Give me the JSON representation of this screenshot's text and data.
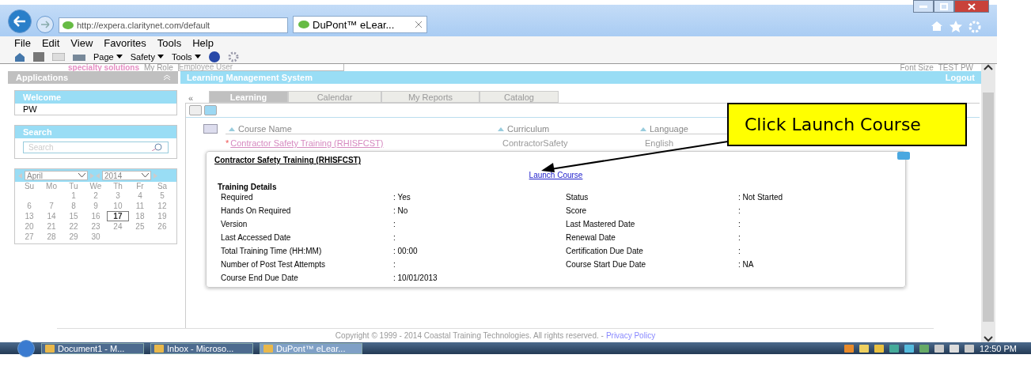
{
  "browser": {
    "address": "http://expera.claritynet.com/default",
    "tab_title": "DuPont™ eLear...",
    "menu": [
      "File",
      "Edit",
      "View",
      "Favorites",
      "Tools",
      "Help"
    ],
    "commands": [
      "Page",
      "Safety",
      "Tools"
    ]
  },
  "header": {
    "brand": "specialty solutions",
    "role_label": "My Role",
    "role_value": "Employee User",
    "font_size_label": "Font Size",
    "user": "TEST PW"
  },
  "left_bar": {
    "title": "Applications"
  },
  "main_bar": {
    "title": "Learning Management System",
    "logout": "Logout"
  },
  "welcome": {
    "title": "Welcome",
    "name": "PW"
  },
  "search": {
    "title": "Search",
    "placeholder": "Search"
  },
  "calendar": {
    "month": "April",
    "year": "2014",
    "weekdays": [
      "Su",
      "Mo",
      "Tu",
      "We",
      "Th",
      "Fr",
      "Sa"
    ],
    "weeks": [
      {
        "kind": "first",
        "days": [
          {
            "day": "1",
            "selected": false
          },
          {
            "day": "2",
            "selected": false
          },
          {
            "day": "3",
            "selected": false
          },
          {
            "day": "4",
            "selected": false
          },
          {
            "day": "5",
            "selected": false
          }
        ]
      },
      {
        "kind": "full",
        "days": [
          {
            "day": "6",
            "selected": false
          },
          {
            "day": "7",
            "selected": false
          },
          {
            "day": "8",
            "selected": false
          },
          {
            "day": "9",
            "selected": false
          },
          {
            "day": "10",
            "selected": false
          },
          {
            "day": "11",
            "selected": false
          },
          {
            "day": "12",
            "selected": false
          }
        ]
      },
      {
        "kind": "full",
        "days": [
          {
            "day": "13",
            "selected": false
          },
          {
            "day": "14",
            "selected": false
          },
          {
            "day": "15",
            "selected": false
          },
          {
            "day": "16",
            "selected": false
          },
          {
            "day": "17",
            "selected": true
          },
          {
            "day": "18",
            "selected": false
          },
          {
            "day": "19",
            "selected": false
          }
        ]
      },
      {
        "kind": "full",
        "days": [
          {
            "day": "20",
            "selected": false
          },
          {
            "day": "21",
            "selected": false
          },
          {
            "day": "22",
            "selected": false
          },
          {
            "day": "23",
            "selected": false
          },
          {
            "day": "24",
            "selected": false
          },
          {
            "day": "25",
            "selected": false
          },
          {
            "day": "26",
            "selected": false
          }
        ]
      },
      {
        "kind": "last",
        "days": [
          {
            "day": "27",
            "selected": false
          },
          {
            "day": "28",
            "selected": false
          },
          {
            "day": "29",
            "selected": false
          },
          {
            "day": "30",
            "selected": false
          }
        ]
      }
    ]
  },
  "collapse": "«",
  "tabs": [
    {
      "label": "Learning",
      "selected": true
    },
    {
      "label": "Calendar",
      "selected": false
    },
    {
      "label": "My Reports",
      "selected": false
    },
    {
      "label": "Catalog",
      "selected": false
    }
  ],
  "table": {
    "columns": [
      "Course Name",
      "Curriculum",
      "Language"
    ],
    "rows": [
      {
        "required_mark": "*",
        "course": "Contractor Safety Training  (RHISFCST)",
        "curriculum": "ContractorSafety",
        "language": "English"
      }
    ]
  },
  "popup": {
    "title": "Contractor Safety Training  (RHISFCST)",
    "launch": "Launch Course",
    "section": "Training Details",
    "left": [
      {
        "label": "Required",
        "value": ": Yes"
      },
      {
        "label": "Hands On Required",
        "value": ": No"
      },
      {
        "label": "Version",
        "value": ":"
      },
      {
        "label": "Last Accessed Date",
        "value": ":"
      },
      {
        "label": "Total Training Time (HH:MM)",
        "value": ": 00:00"
      },
      {
        "label": "Number of Post Test Attempts",
        "value": ":"
      },
      {
        "label": "Course End Due Date",
        "value": ": 10/01/2013"
      }
    ],
    "right": [
      {
        "label": "Status",
        "value": ": Not Started"
      },
      {
        "label": "Score",
        "value": ":"
      },
      {
        "label": "Last Mastered Date",
        "value": ":"
      },
      {
        "label": "Renewal Date",
        "value": ":"
      },
      {
        "label": "Certification Due Date",
        "value": ":"
      },
      {
        "label": "Course Start Due Date",
        "value": ": NA"
      }
    ]
  },
  "callout": {
    "text": "Click Launch Course"
  },
  "footer": {
    "copyright": "Copyright © 1999 - 2014 Coastal Training Technologies. All rights reserved. -",
    "link": "Privacy Policy"
  },
  "taskbar": {
    "items": [
      {
        "label": "Document1 - M...",
        "selected": false
      },
      {
        "label": "Inbox - Microso...",
        "selected": false
      },
      {
        "label": "DuPont™ eLear...",
        "selected": true
      }
    ],
    "clock": "12:50 PM"
  }
}
